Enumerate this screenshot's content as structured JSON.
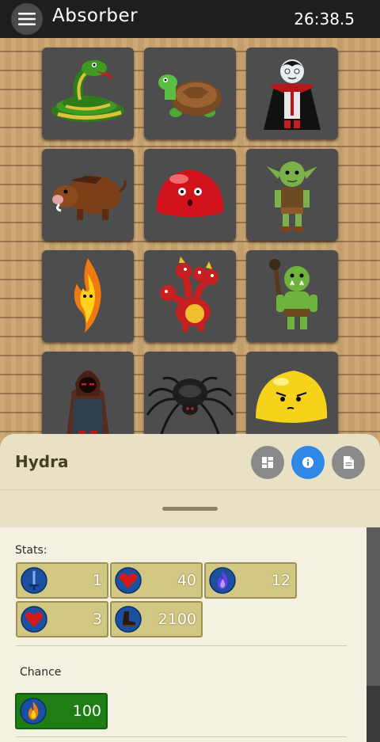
{
  "app": {
    "title": "Absorber",
    "timer": "26:38.5"
  },
  "board": {
    "tiles": [
      {
        "name": "snake"
      },
      {
        "name": "turtle"
      },
      {
        "name": "vampire"
      },
      {
        "name": "boar"
      },
      {
        "name": "red-slime"
      },
      {
        "name": "goblin"
      },
      {
        "name": "fire-spirit"
      },
      {
        "name": "hydra"
      },
      {
        "name": "orc"
      },
      {
        "name": "hooded-rogue"
      },
      {
        "name": "spider"
      },
      {
        "name": "yellow-slime"
      }
    ]
  },
  "sheet": {
    "title": "Hydra",
    "buttons": [
      {
        "icon": "grid-icon",
        "color": "#8a8a8a"
      },
      {
        "icon": "info-icon",
        "color": "#2f87e8"
      },
      {
        "icon": "document-icon",
        "color": "#8a8a8a"
      }
    ],
    "stats_label": "Stats:",
    "stats": [
      {
        "icon": "sword-icon",
        "value": "1"
      },
      {
        "icon": "heart-icon",
        "value": "40"
      },
      {
        "icon": "blue-flame-icon",
        "value": "12"
      },
      {
        "icon": "heart-icon",
        "value": "3"
      },
      {
        "icon": "boot-icon",
        "value": "2100"
      }
    ],
    "chance_label": "Chance",
    "chance": {
      "icon": "fire-icon",
      "value": "100"
    }
  },
  "colors": {
    "stat_bg": "#d3c784",
    "chance_bg": "#1f7d16",
    "accent_blue": "#2f87e8",
    "tile_bg": "#4d4d4d"
  }
}
